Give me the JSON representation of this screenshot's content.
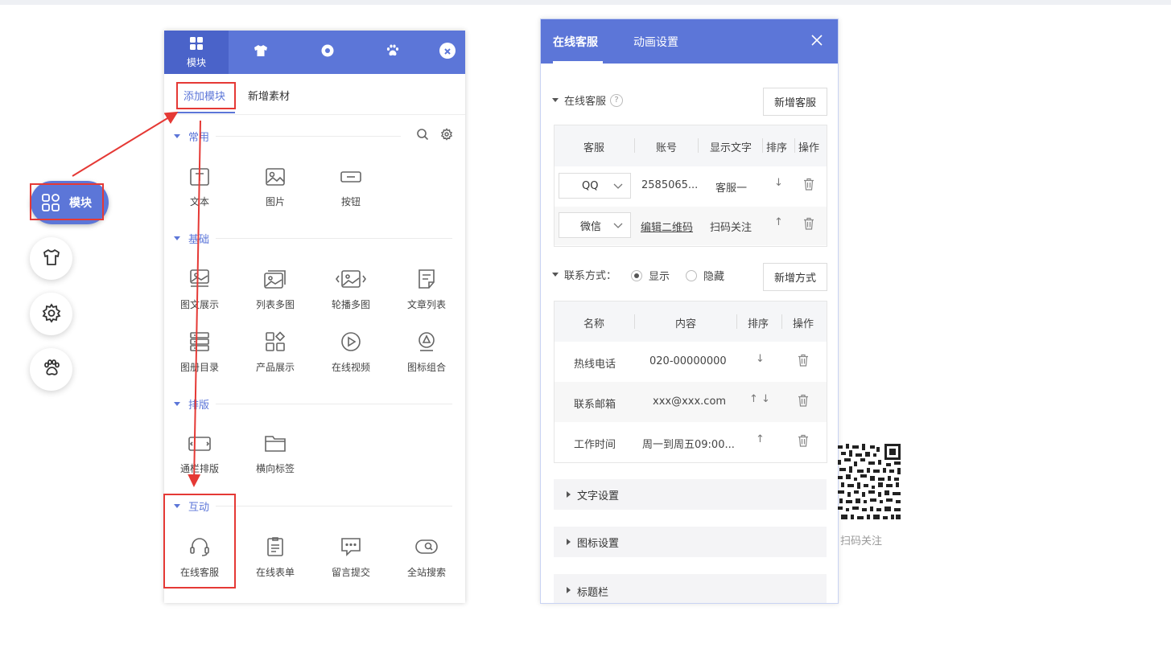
{
  "dock": {
    "main_label": "模块",
    "buttons": [
      "shirt-icon",
      "gear-icon",
      "paw-icon"
    ]
  },
  "module_panel": {
    "top_tabs": [
      {
        "label": "模块",
        "icon": "grid-icon"
      },
      {
        "label": "",
        "icon": "shirt-icon"
      },
      {
        "label": "",
        "icon": "gear-icon"
      },
      {
        "label": "",
        "icon": "paw-icon"
      }
    ],
    "sub_tabs": [
      "添加模块",
      "新增素材"
    ],
    "sections": [
      {
        "title": "常用",
        "items": [
          "文本",
          "图片",
          "按钮"
        ]
      },
      {
        "title": "基础",
        "items": [
          "图文展示",
          "列表多图",
          "轮播多图",
          "文章列表",
          "图册目录",
          "产品展示",
          "在线视频",
          "图标组合"
        ]
      },
      {
        "title": "排版",
        "items": [
          "通栏排版",
          "横向标签"
        ]
      },
      {
        "title": "互动",
        "items": [
          "在线客服",
          "在线表单",
          "留言提交",
          "全站搜索"
        ]
      }
    ]
  },
  "service_panel": {
    "tabs": [
      "在线客服",
      "动画设置"
    ],
    "online_service": {
      "label": "在线客服",
      "help": "?",
      "add_button": "新增客服",
      "columns": [
        "客服",
        "账号",
        "显示文字",
        "排序",
        "操作"
      ],
      "rows": [
        {
          "type": "QQ",
          "account": "2585065...",
          "text": "客服一",
          "sort": "↓"
        },
        {
          "type": "微信",
          "account": "编辑二维码",
          "text": "扫码关注",
          "sort": "↑"
        }
      ]
    },
    "contact": {
      "label": "联系方式：",
      "show": "显示",
      "hide": "隐藏",
      "add_button": "新增方式",
      "columns": [
        "名称",
        "内容",
        "排序",
        "操作"
      ],
      "rows": [
        {
          "name": "热线电话",
          "content": "020-00000000",
          "sort": "↓"
        },
        {
          "name": "联系邮箱",
          "content": "xxx@xxx.com",
          "sort": "↑ ↓"
        },
        {
          "name": "工作时间",
          "content": "周一到周五09:00...",
          "sort": "↑"
        }
      ]
    },
    "collapsed": [
      "文字设置",
      "图标设置",
      "标题栏"
    ]
  },
  "qr": {
    "label": "扫码关注"
  },
  "colors": {
    "accent": "#5c76d8",
    "highlight": "#e53935"
  }
}
